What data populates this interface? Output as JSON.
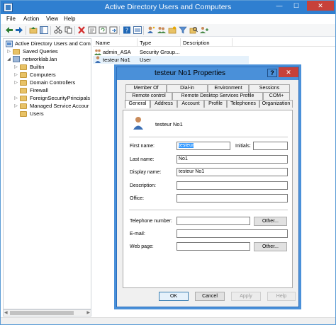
{
  "window": {
    "title": "Active Directory Users and Computers",
    "min": "—",
    "max": "☐",
    "close": "✕"
  },
  "menu": [
    "File",
    "Action",
    "View",
    "Help"
  ],
  "tree": {
    "root": "Active Directory Users and Com",
    "items": [
      {
        "label": "Saved Queries",
        "expand": "▷"
      },
      {
        "label": "networklab.lan",
        "expand": "◢"
      },
      {
        "label": "Builtin",
        "expand": "▷"
      },
      {
        "label": "Computers",
        "expand": "▷"
      },
      {
        "label": "Domain Controllers",
        "expand": "▷"
      },
      {
        "label": "Firewall",
        "expand": ""
      },
      {
        "label": "ForeignSecurityPrincipals",
        "expand": "▷"
      },
      {
        "label": "Managed Service Accour",
        "expand": "▷"
      },
      {
        "label": "Users",
        "expand": ""
      }
    ]
  },
  "list": {
    "columns": [
      "Name",
      "Type",
      "Description"
    ],
    "rows": [
      {
        "name": "admin_ASA",
        "type": "Security Group..."
      },
      {
        "name": "testeur No1",
        "type": "User"
      }
    ]
  },
  "dialog": {
    "title": "testeur No1 Properties",
    "help": "?",
    "close": "✕",
    "tabs_row1": [
      "Member Of",
      "Dial-in",
      "Environment",
      "Sessions"
    ],
    "tabs_row2": [
      "Remote control",
      "Remote Desktop Services Profile",
      "COM+"
    ],
    "tabs_row3": [
      "General",
      "Address",
      "Account",
      "Profile",
      "Telephones",
      "Organization"
    ],
    "active_tab": "General",
    "user_display": "testeur No1",
    "labels": {
      "first_name": "First name:",
      "initials": "Initials:",
      "last_name": "Last name:",
      "display_name": "Display name:",
      "description": "Description:",
      "office": "Office:",
      "telephone": "Telephone number:",
      "email": "E-mail:",
      "webpage": "Web page:"
    },
    "values": {
      "first_name": "testeur",
      "initials": "",
      "last_name": "No1",
      "display_name": "testeur No1",
      "description": "",
      "office": "",
      "telephone": "",
      "email": "",
      "webpage": ""
    },
    "buttons": {
      "other_phone": "Other...",
      "other_web": "Other...",
      "ok": "OK",
      "cancel": "Cancel",
      "apply": "Apply",
      "help": "Help"
    }
  },
  "colors": {
    "titlebar": "#2f7fd0",
    "dialog_titlebar": "#4a90d9",
    "close_red": "#c7413a",
    "selection": "#3399ff"
  }
}
